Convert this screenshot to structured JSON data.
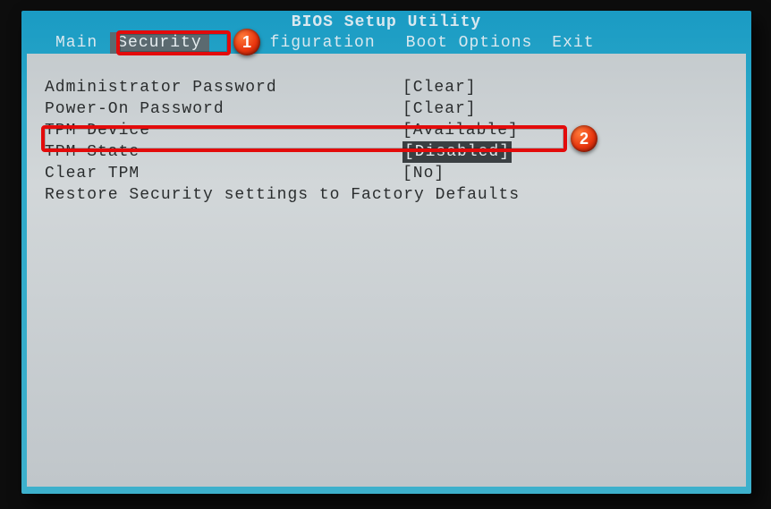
{
  "title": "BIOS Setup Utility",
  "tabs": {
    "main": "Main",
    "security": "Security",
    "config_visible_part": "figuration",
    "boot": "Boot Options",
    "exit": "Exit"
  },
  "rows": {
    "admin_pw": {
      "label": "Administrator Password",
      "value": "[Clear]"
    },
    "poweron_pw": {
      "label": "Power-On Password",
      "value": "[Clear]"
    },
    "tpm_dev": {
      "label": "TPM Device",
      "value": "[Available]"
    },
    "tpm_state": {
      "label": "TPM State",
      "value": "[Disabled]"
    },
    "clear_tpm": {
      "label": "Clear TPM",
      "value": "[No]"
    },
    "restore": {
      "label": "Restore Security settings to Factory Defaults",
      "value": ""
    }
  },
  "callouts": {
    "n1": "1",
    "n2": "2"
  }
}
